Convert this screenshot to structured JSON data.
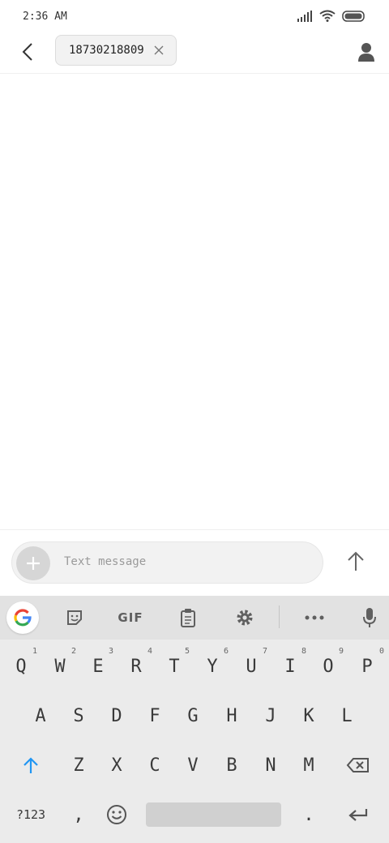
{
  "status": {
    "time": "2:36 AM"
  },
  "conversation": {
    "recipient_chip": "18730218809"
  },
  "composer": {
    "placeholder": "Text message"
  },
  "keyboard": {
    "toolbar": {
      "gif_label": "GIF"
    },
    "row1": [
      {
        "key": "Q",
        "hint": "1"
      },
      {
        "key": "W",
        "hint": "2"
      },
      {
        "key": "E",
        "hint": "3"
      },
      {
        "key": "R",
        "hint": "4"
      },
      {
        "key": "T",
        "hint": "5"
      },
      {
        "key": "Y",
        "hint": "6"
      },
      {
        "key": "U",
        "hint": "7"
      },
      {
        "key": "I",
        "hint": "8"
      },
      {
        "key": "O",
        "hint": "9"
      },
      {
        "key": "P",
        "hint": "0"
      }
    ],
    "row2": [
      "A",
      "S",
      "D",
      "F",
      "G",
      "H",
      "J",
      "K",
      "L"
    ],
    "row3": [
      "Z",
      "X",
      "C",
      "V",
      "B",
      "N",
      "M"
    ],
    "row4": {
      "symbols_label": "?123",
      "comma": ",",
      "period": "."
    }
  },
  "colors": {
    "shift_active": "#2196F3",
    "keyboard_bg": "#ebebeb",
    "toolbar_bg": "#e2e2e2"
  },
  "icons": [
    "back-arrow-icon",
    "close-icon",
    "contact-icon",
    "plus-icon",
    "send-arrow-icon",
    "google-icon",
    "sticker-icon",
    "clipboard-icon",
    "gear-icon",
    "more-icon",
    "mic-icon",
    "shift-icon",
    "backspace-icon",
    "emoji-icon",
    "enter-icon"
  ]
}
